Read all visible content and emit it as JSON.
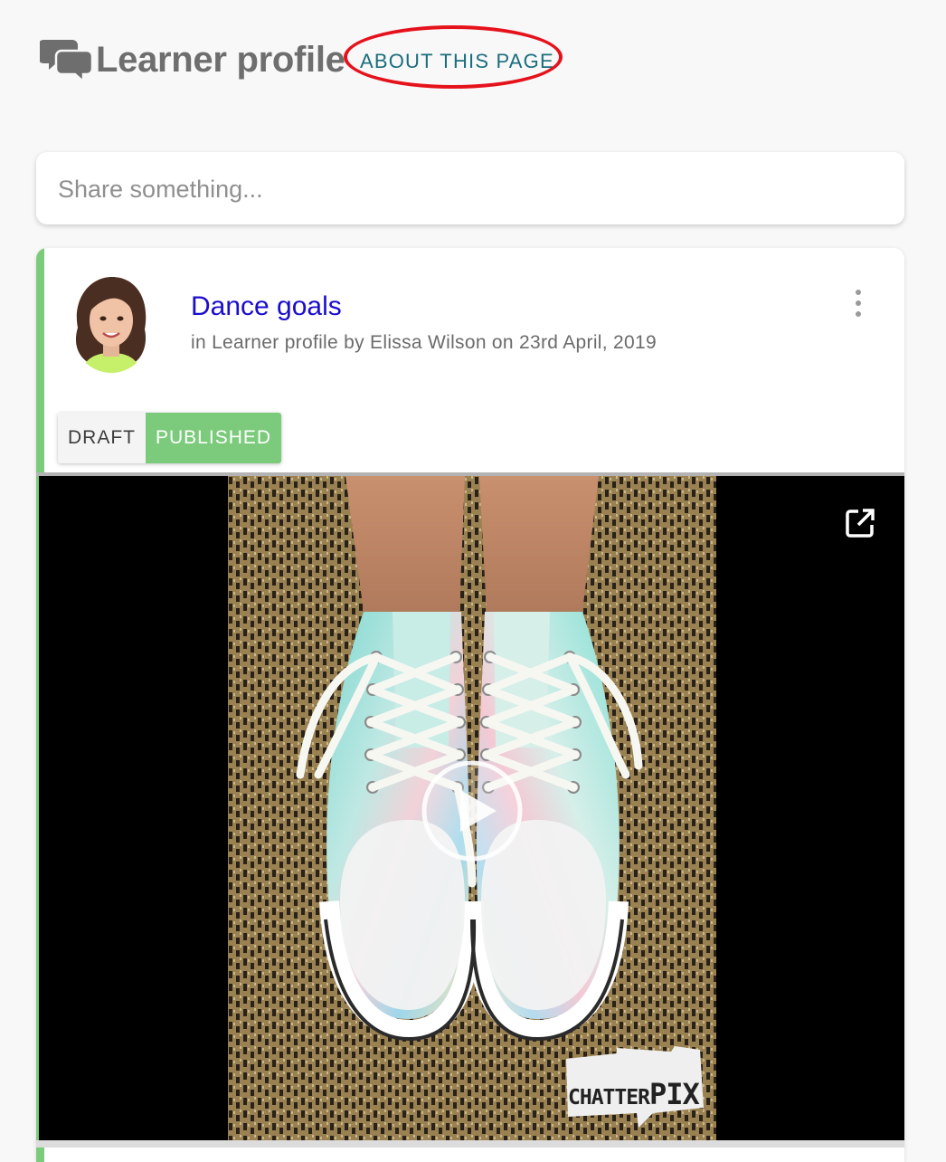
{
  "header": {
    "icon": "chat-bubbles-icon",
    "title": "Learner profile",
    "about_link": "ABOUT THIS PAGE",
    "highlight_color": "#e5121b"
  },
  "share": {
    "placeholder": "Share something...",
    "value": ""
  },
  "post": {
    "title": "Dance goals",
    "meta": "in Learner profile by Elissa Wilson on 23rd April, 2019",
    "avatar": "student-avatar",
    "more_icon": "more-vertical-icon",
    "status": {
      "options": [
        "DRAFT",
        "PUBLISHED"
      ],
      "selected": "PUBLISHED"
    },
    "accent_color": "#7ccb7c",
    "title_color": "#1a0dcc",
    "media": {
      "type": "video",
      "open_icon": "open-external-icon",
      "play_icon": "play-icon",
      "watermark": {
        "part1": "CHATTER",
        "part2": "PIX"
      }
    }
  }
}
